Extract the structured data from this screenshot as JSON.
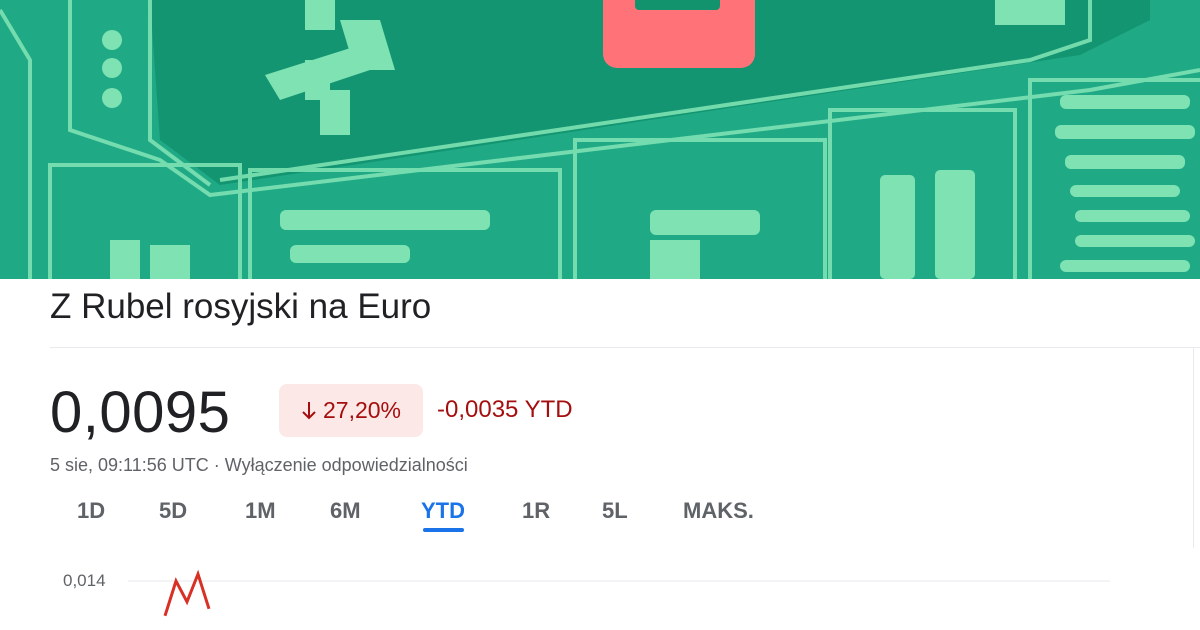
{
  "header": {
    "title": "Z Rubel rosyjski na Euro"
  },
  "quote": {
    "price": "0,0095",
    "change_percent": "27,20%",
    "change_direction": "down",
    "change_abs": "-0,0035 YTD",
    "timestamp": "5 sie, 09:11:56 UTC",
    "separator": "·",
    "disclaimer": "Wyłączenie odpowiedzialności"
  },
  "range_tabs": {
    "selected": "YTD",
    "items": [
      {
        "label": "1D"
      },
      {
        "label": "5D"
      },
      {
        "label": "1M"
      },
      {
        "label": "6M"
      },
      {
        "label": "YTD"
      },
      {
        "label": "1R"
      },
      {
        "label": "5L"
      },
      {
        "label": "MAKS."
      }
    ]
  },
  "chart_data": {
    "type": "line",
    "y_tick_labels": [
      "0,014"
    ],
    "series": [
      {
        "values": [
          0.0135,
          0.014,
          0.0137,
          0.0141,
          0.0136
        ]
      }
    ],
    "ylim": [
      0.012,
      0.014
    ],
    "grid": true,
    "line_color": "#d93025"
  },
  "colors": {
    "banner_bg": "#1fa985",
    "banner_accent": "#6fdc9e",
    "negative": "#a50e0e",
    "negative_bg": "#fce8e6",
    "active_tab": "#1a73e8"
  }
}
